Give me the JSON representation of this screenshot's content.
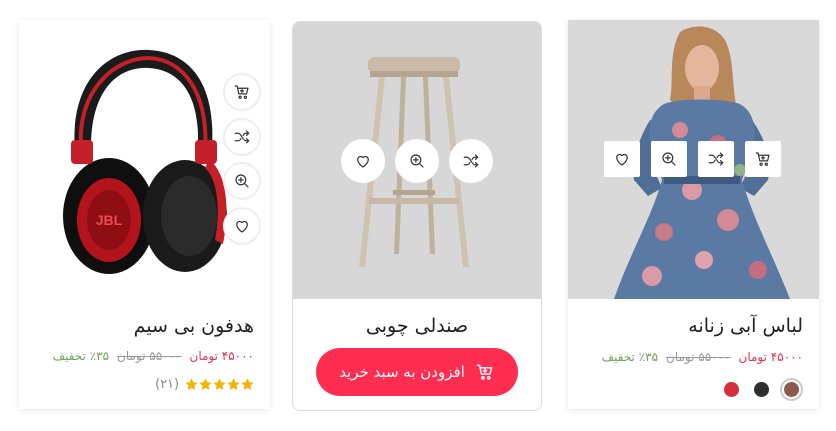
{
  "products": [
    {
      "title": "لباس آبی زنانه",
      "price_new": "۴۵۰۰۰ تومان",
      "price_old": "۵۵۰۰۰ تومان",
      "discount": "٪۳۵ تخفیف",
      "colors": [
        "#8b5a4a",
        "#2e2e2e",
        "#d62e3a"
      ]
    },
    {
      "title": "صندلی چوبی",
      "add_to_cart": "افزودن به سبد خرید"
    },
    {
      "title": "هدفون بی سیم",
      "price_new": "۴۵۰۰۰ تومان",
      "price_old": "۵۵۰۰۰ تومان",
      "discount": "٪۳۵ تخفیف",
      "rating_count": "(۲۱)",
      "rating_value": 5,
      "rating_max": 5
    }
  ],
  "icons": {
    "cart": "cart-icon",
    "shuffle": "shuffle-icon",
    "zoom": "zoom-in-icon",
    "heart": "heart-icon"
  },
  "colors": {
    "accent": "#ff2e51",
    "price": "#e8344e",
    "discount": "#6aa35a",
    "star": "#f5b301"
  },
  "symbols": {
    "logo_text": "JBL"
  }
}
